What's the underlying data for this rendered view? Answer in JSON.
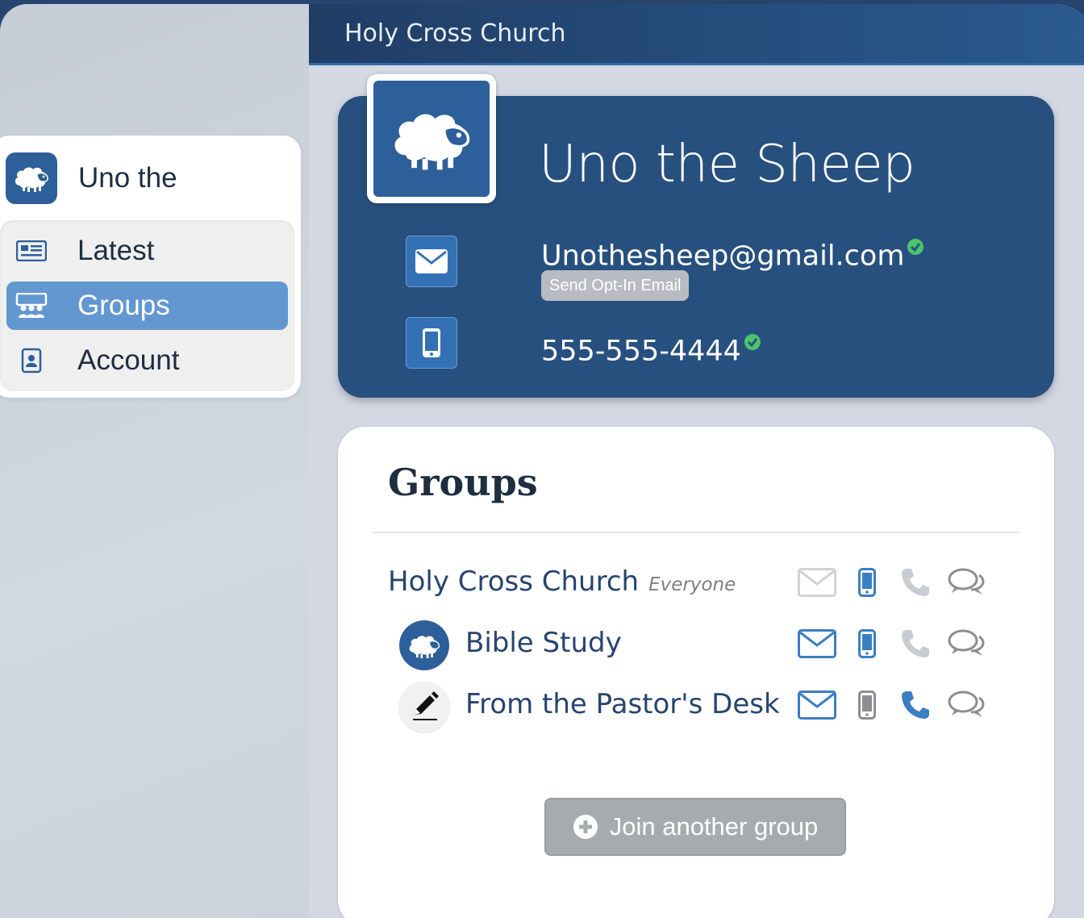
{
  "header": {
    "church_name": "Holy Cross Church"
  },
  "user_menu": {
    "name": "Uno the",
    "items": [
      {
        "label": "Latest",
        "icon": "newspaper-icon",
        "active": false
      },
      {
        "label": "Groups",
        "icon": "groups-icon",
        "active": true
      },
      {
        "label": "Account",
        "icon": "contact-card-icon",
        "active": false
      }
    ]
  },
  "profile": {
    "name": "Uno the Sheep",
    "email": "Unothesheep@gmail.com",
    "phone": "555-555-4444",
    "opt_in_label": "Send Opt-In Email"
  },
  "groups": {
    "title": "Groups",
    "rows": [
      {
        "name": "Holy Cross Church",
        "sub": "Everyone",
        "avatar": "none"
      },
      {
        "name": "Bible Study",
        "sub": "",
        "avatar": "sheep-icon"
      },
      {
        "name": "From the Pastor's Desk",
        "sub": "",
        "avatar": "pencil-icon"
      }
    ],
    "join_label": "Join another group"
  },
  "colors": {
    "brand_blue": "#27507f",
    "accent_blue": "#3a7fc2",
    "active_nav": "#6297d0",
    "verified_green": "#4cc46a"
  }
}
